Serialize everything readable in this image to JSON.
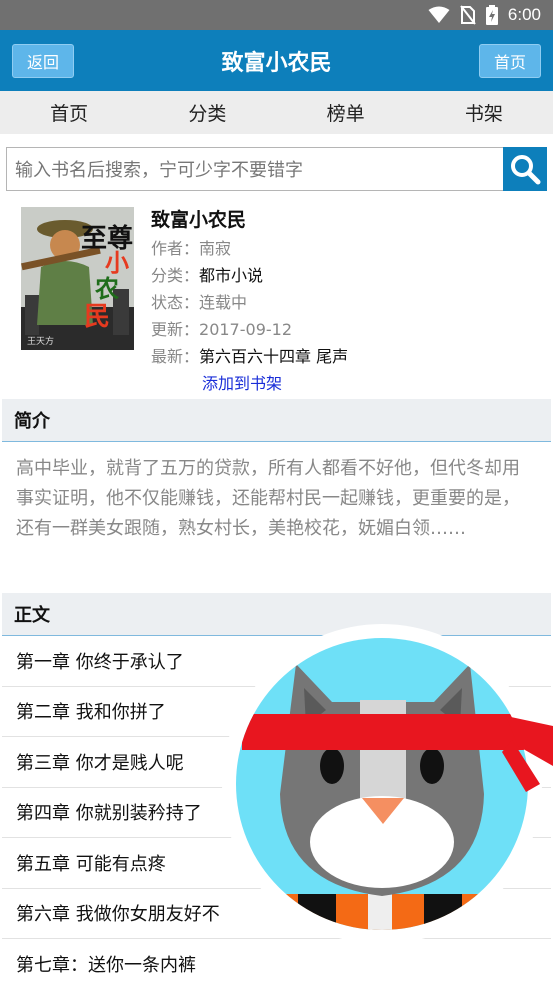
{
  "status_bar": {
    "time": "6:00"
  },
  "header": {
    "back_label": "返回",
    "title": "致富小农民",
    "home_label": "首页"
  },
  "nav": {
    "items": [
      "首页",
      "分类",
      "榜单",
      "书架"
    ]
  },
  "search": {
    "placeholder": "输入书名后搜索，宁可少字不要错字"
  },
  "book": {
    "cover_text": [
      "至尊",
      "小",
      "农",
      "民",
      "王天方"
    ],
    "name": "致富小农民",
    "author_label": "作者：",
    "author": "南寂",
    "category_label": "分类：",
    "category": "都市小说",
    "status_label": "状态：",
    "status": "连载中",
    "updated_label": "更新：",
    "updated": "2017-09-12",
    "latest_label": "最新：",
    "latest": "第六百六十四章 尾声",
    "add_shelf": "添加到书架"
  },
  "intro": {
    "title": "简介",
    "text": "高中毕业，就背了五万的贷款，所有人都看不好他，但代冬却用事实证明，他不仅能赚钱，还能帮村民一起赚钱，更重要的是，还有一群美女跟随，熟女村长，美艳校花，妩媚白领……"
  },
  "chapters": {
    "title": "正文",
    "items": [
      "第一章 你终于承认了",
      "第二章 我和你拼了",
      "第三章 你才是贱人呢",
      "第四章 你就别装矜持了",
      "第五章 可能有点疼",
      "第六章 我做你女朋友好不",
      "第七章：送你一条内裤"
    ]
  },
  "colors": {
    "brand": "#0d7fbb",
    "button": "#5eb6ea",
    "link": "#1a2ed8",
    "mascot_bg": "#6ee0f7",
    "headband": "#e8161f"
  }
}
